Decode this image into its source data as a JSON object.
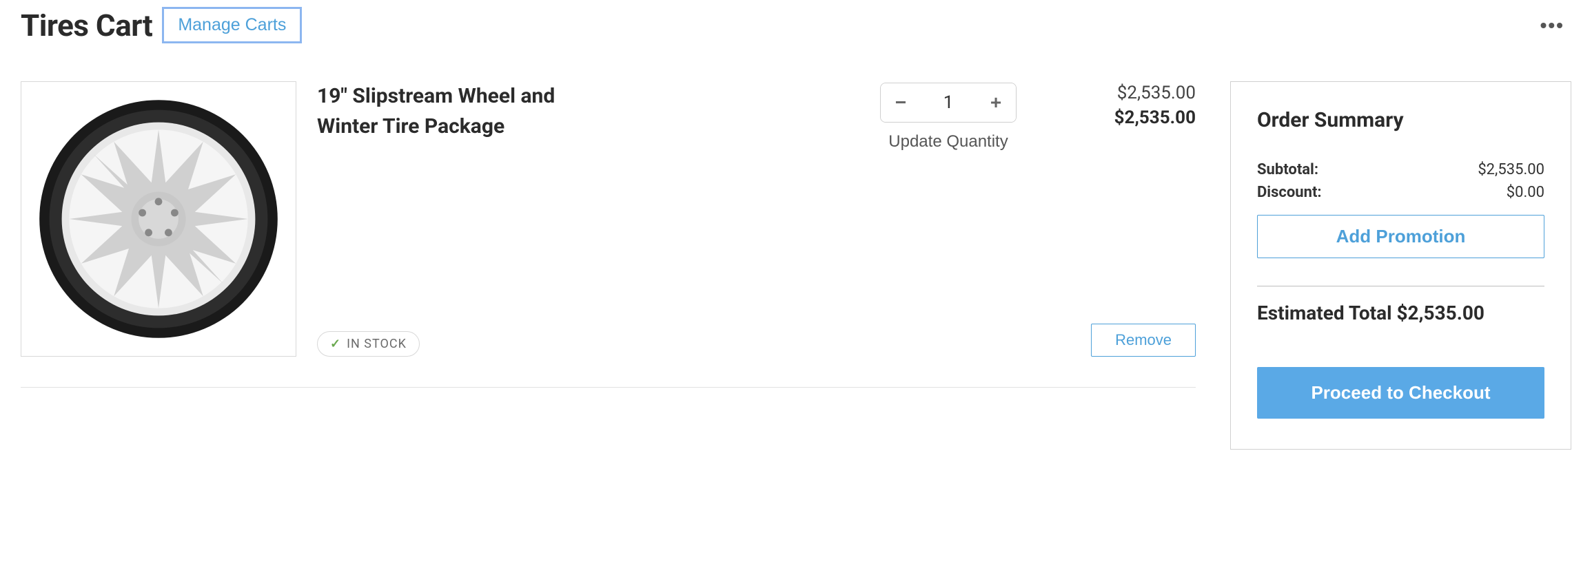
{
  "header": {
    "title": "Tires Cart",
    "manage_carts_label": "Manage Carts"
  },
  "cart": {
    "items": [
      {
        "name": "19\" Slipstream Wheel and Winter Tire Package",
        "stock_status": "IN STOCK",
        "quantity": "1",
        "unit_price": "$2,535.00",
        "line_total": "$2,535.00",
        "update_quantity_label": "Update Quantity",
        "remove_label": "Remove"
      }
    ]
  },
  "summary": {
    "title": "Order Summary",
    "subtotal_label": "Subtotal:",
    "subtotal_value": "$2,535.00",
    "discount_label": "Discount:",
    "discount_value": "$0.00",
    "promo_label": "Add Promotion",
    "estimated_total_label": "Estimated Total",
    "estimated_total_value": "$2,535.00",
    "checkout_label": "Proceed to Checkout"
  }
}
